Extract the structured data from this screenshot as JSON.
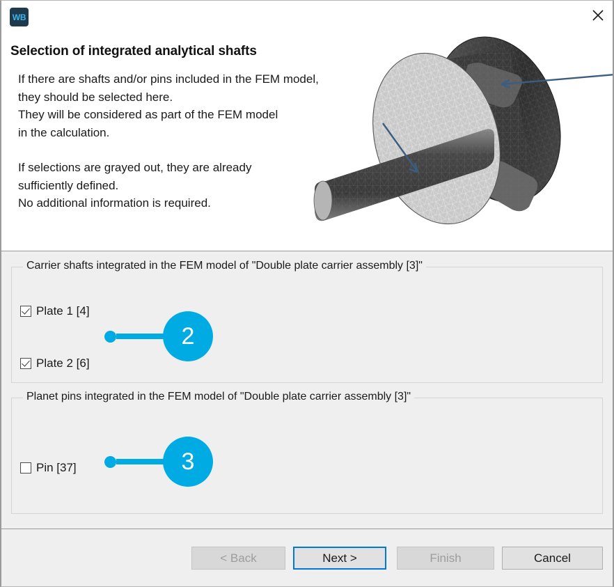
{
  "window": {
    "app_icon_label": "WB",
    "close_icon": "close-icon"
  },
  "header": {
    "title": "Selection of integrated analytical shafts",
    "paragraph_1_line_1": "If there are shafts and/or pins included in the FEM model,",
    "paragraph_1_line_2": "they should be selected here.",
    "paragraph_1_line_3": "They will be considered as part of the FEM model",
    "paragraph_1_line_4": "in the calculation.",
    "paragraph_2_line_1": "If selections are grayed out, they are already",
    "paragraph_2_line_2": "sufficiently defined.",
    "paragraph_2_line_3": "No additional information is required."
  },
  "illustration": {
    "name": "fem-mesh-carrier-assembly",
    "description": "Shaded triangular FEM mesh of a double plate carrier assembly with a central shaft and planet pins, annotated with two pointer arrows"
  },
  "groups": [
    {
      "id": "carrier-shafts",
      "title": "Carrier shafts integrated in the FEM model of \"Double plate carrier assembly [3]\"",
      "items": [
        {
          "label": "Plate 1 [4]",
          "checked": true
        },
        {
          "label": "Plate 2 [6]",
          "checked": true
        }
      ]
    },
    {
      "id": "planet-pins",
      "title": "Planet pins integrated in the FEM model of \"Double plate carrier assembly [3]\"",
      "items": [
        {
          "label": "Pin [37]",
          "checked": false
        }
      ]
    }
  ],
  "callouts": [
    {
      "number": "2",
      "target": "carrier-shafts-group"
    },
    {
      "number": "3",
      "target": "planet-pins-group"
    }
  ],
  "footer": {
    "buttons": [
      {
        "label": "< Back",
        "state": "disabled"
      },
      {
        "label": "Next >",
        "state": "focused"
      },
      {
        "label": "Finish",
        "state": "disabled"
      },
      {
        "label": "Cancel",
        "state": "enabled"
      }
    ]
  },
  "colors": {
    "accent": "#00ABE3",
    "focus": "#0078D7",
    "panel": "#EFEFEF",
    "icon_bg": "#1F3A4D",
    "icon_fg": "#3FB3E8"
  }
}
